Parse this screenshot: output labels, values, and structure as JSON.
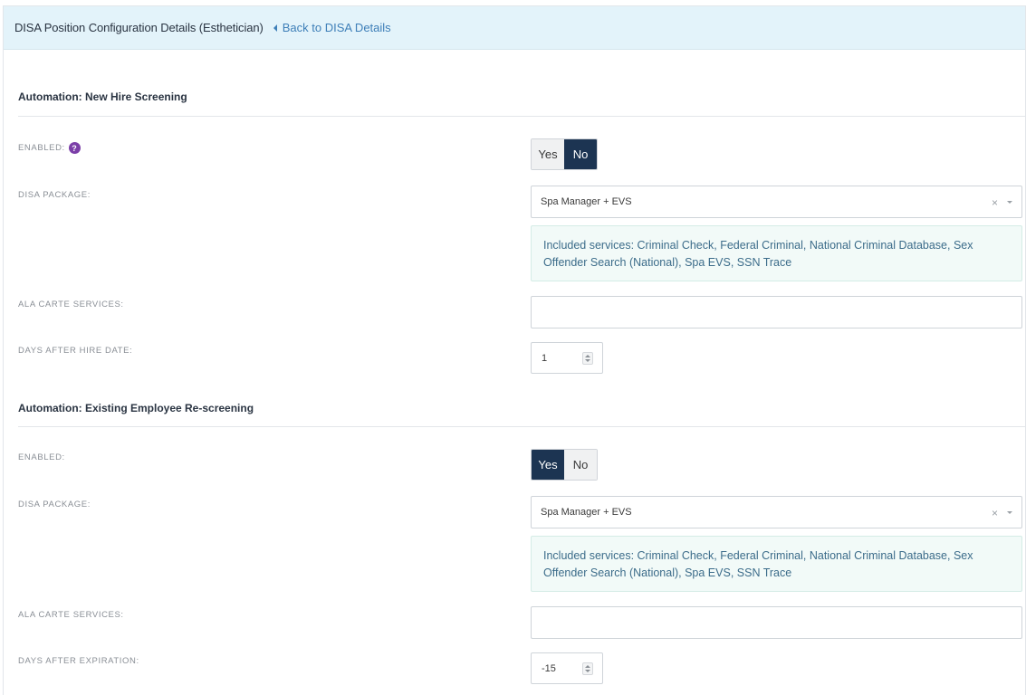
{
  "header": {
    "title": "DISA Position Configuration Details (Esthetician)",
    "back_link": "Back to DISA Details"
  },
  "sections": [
    {
      "title": "Automation: New Hire Screening",
      "enabled_label": "ENABLED:",
      "help_icon": "?",
      "toggle": {
        "yes": "Yes",
        "no": "No",
        "selected": "No"
      },
      "package_label": "DISA PACKAGE:",
      "package_value": "Spa Manager + EVS",
      "clear_symbol": "×",
      "included_services": "Included services: Criminal Check, Federal Criminal, National Criminal Database, Sex Offender Search (National), Spa EVS, SSN Trace",
      "ala_carte_label": "ALA CARTE SERVICES:",
      "ala_carte_value": "",
      "days_label": "DAYS AFTER HIRE DATE:",
      "days_value": "1"
    },
    {
      "title": "Automation: Existing Employee Re-screening",
      "enabled_label": "ENABLED:",
      "toggle": {
        "yes": "Yes",
        "no": "No",
        "selected": "Yes"
      },
      "package_label": "DISA PACKAGE:",
      "package_value": "Spa Manager + EVS",
      "clear_symbol": "×",
      "included_services": "Included services: Criminal Check, Federal Criminal, National Criminal Database, Sex Offender Search (National), Spa EVS, SSN Trace",
      "ala_carte_label": "ALA CARTE SERVICES:",
      "ala_carte_value": "",
      "days_label": "DAYS AFTER EXPIRATION:",
      "days_value": "-15"
    }
  ],
  "colors": {
    "header_bg": "#e3f3fa",
    "link": "#3e7fb8",
    "toggle_active": "#1c3452",
    "help_icon": "#7b3fa8",
    "info_bg": "#f2faf8"
  }
}
